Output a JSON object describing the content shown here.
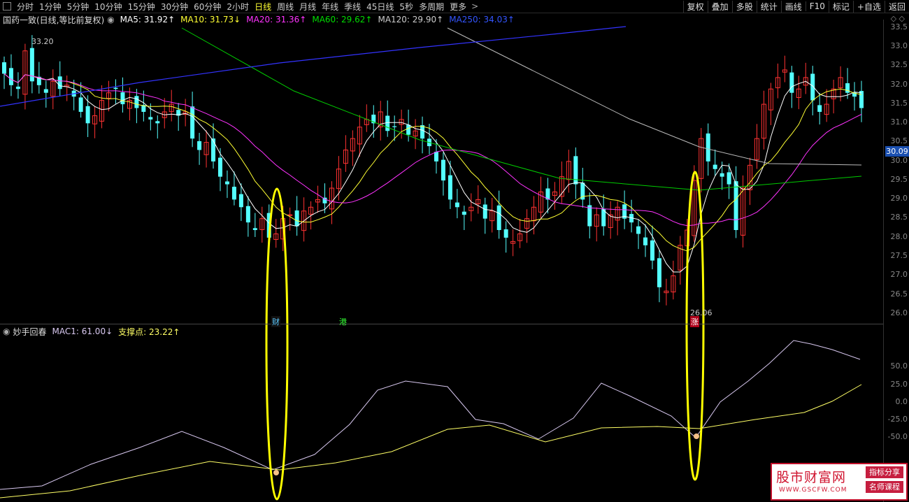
{
  "toolbar": {
    "periods": [
      "分时",
      "1分钟",
      "5分钟",
      "10分钟",
      "15分钟",
      "30分钟",
      "60分钟",
      "2小时",
      "日线",
      "周线",
      "月线",
      "年线",
      "季线",
      "45日线",
      "5秒",
      "多周期",
      "更多"
    ],
    "active_period": "日线",
    "right_buttons": [
      "复权",
      "叠加",
      "多股",
      "统计",
      "画线",
      "F10",
      "+自选",
      "返回"
    ],
    "right_label": "标记"
  },
  "info": {
    "stock": "国药一致(日线,等比前复权)",
    "ma5": "MA5: 31.92↑",
    "ma10": "MA10: 31.73↓",
    "ma20": "MA20: 31.36↑",
    "ma60": "MA60: 29.62↑",
    "ma120": "MA120: 29.90↑",
    "ma250": "MA250: 34.03↑"
  },
  "colors": {
    "up": "#ff3232",
    "down": "#54ffff",
    "ma5": "#ffffff",
    "ma10": "#ffff33",
    "ma20": "#ff33ff",
    "ma60": "#00cc00",
    "ma120": "#bbbbbb",
    "ma250": "#3333ff",
    "highlight": "#ffff00",
    "mac1": "#d8c8f0",
    "support": "#ffff66"
  },
  "price_axis": [
    "33.5",
    "33.0",
    "32.5",
    "32.0",
    "31.5",
    "31.0",
    "30.5",
    "30.0",
    "29.5",
    "29.0",
    "28.5",
    "28.0",
    "27.5",
    "27.0",
    "26.5",
    "26.0"
  ],
  "current_price": "30.09",
  "annotations": {
    "high": "33.20",
    "low": "26.06",
    "marker_cai": "财",
    "marker_gang": "港",
    "marker_zhang": "涨"
  },
  "indicator": {
    "name": "妙手回春",
    "mac1": "MAC1: 61.00↓",
    "support": "支撑点: 23.22↑",
    "axis": [
      "50.0",
      "25.0",
      "0.0",
      "-25.0",
      "-50.0"
    ]
  },
  "watermark": {
    "main": "股市财富网",
    "url": "WWW.GSCFW.COM",
    "tag1": "指标分享",
    "tag2": "名师课程"
  }
}
